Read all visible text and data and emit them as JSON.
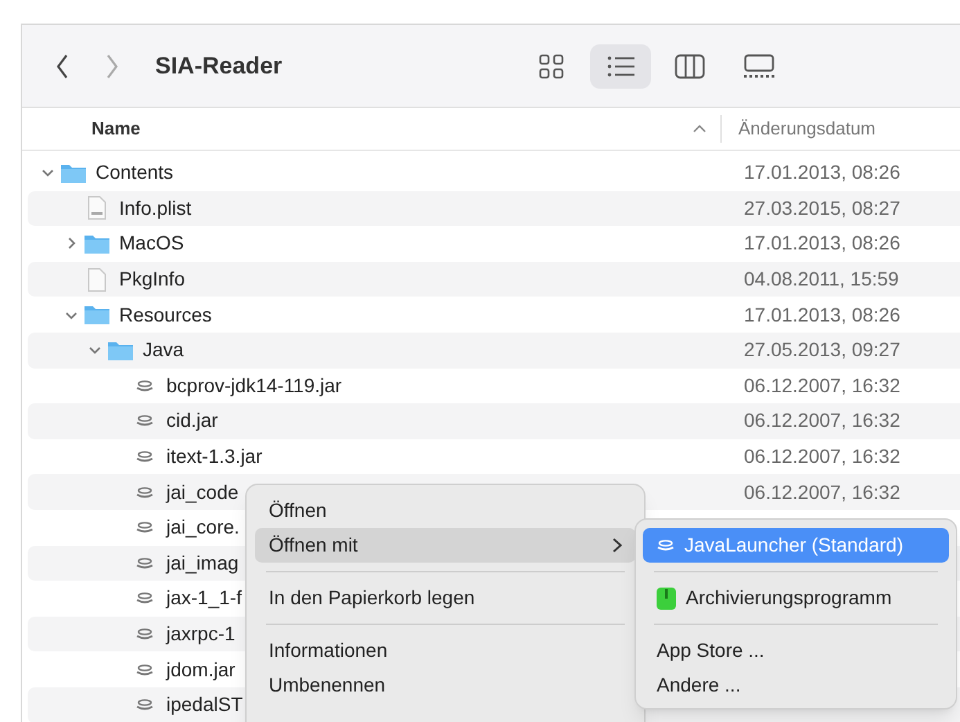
{
  "window": {
    "title": "SIA-Reader"
  },
  "toolbar": {
    "views": [
      {
        "kind": "icons",
        "selected": false
      },
      {
        "kind": "list",
        "selected": true
      },
      {
        "kind": "columns",
        "selected": false
      },
      {
        "kind": "gallery",
        "selected": false
      }
    ]
  },
  "columns": [
    {
      "label": "Name",
      "sorted": true
    },
    {
      "label": "Änderungsdatum",
      "sorted": false
    }
  ],
  "rows": [
    {
      "name": "Contents",
      "kind": "folder",
      "expanded": true,
      "date": "17.01.2013, 08:26",
      "children": [
        {
          "name": "Info.plist",
          "kind": "plist",
          "date": "27.03.2015, 08:27"
        },
        {
          "name": "MacOS",
          "kind": "folder",
          "expanded": false,
          "date": "17.01.2013, 08:26"
        },
        {
          "name": "PkgInfo",
          "kind": "file",
          "date": "04.08.2011, 15:59"
        },
        {
          "name": "Resources",
          "kind": "folder",
          "expanded": true,
          "date": "17.01.2013, 08:26",
          "children": [
            {
              "name": "Java",
              "kind": "folder",
              "expanded": true,
              "date": "27.05.2013, 09:27",
              "children": [
                {
                  "name": "bcprov-jdk14-119.jar",
                  "kind": "jar",
                  "date": "06.12.2007, 16:32"
                },
                {
                  "name": "cid.jar",
                  "kind": "jar",
                  "date": "06.12.2007, 16:32"
                },
                {
                  "name": "itext-1.3.jar",
                  "kind": "jar",
                  "date": "06.12.2007, 16:32"
                },
                {
                  "name": "jai_code",
                  "kind": "jar",
                  "date": "06.12.2007, 16:32"
                },
                {
                  "name": "jai_core.",
                  "kind": "jar"
                },
                {
                  "name": "jai_imag",
                  "kind": "jar"
                },
                {
                  "name": "jax-1_1-f",
                  "kind": "jar"
                },
                {
                  "name": "jaxrpc-1",
                  "kind": "jar"
                },
                {
                  "name": "jdom.jar",
                  "kind": "jar"
                },
                {
                  "name": "ipedalST",
                  "kind": "jar"
                }
              ]
            }
          ]
        }
      ]
    }
  ],
  "context_menu": [
    {
      "kind": "item",
      "label": "Öffnen",
      "selected": false
    },
    {
      "kind": "submenu",
      "label": "Öffnen mit",
      "selected": true
    },
    {
      "kind": "separator"
    },
    {
      "kind": "item",
      "label": "In den Papierkorb legen",
      "selected": false
    },
    {
      "kind": "separator"
    },
    {
      "kind": "item",
      "label": "Informationen",
      "selected": false
    },
    {
      "kind": "item",
      "label": "Umbenennen",
      "selected": false
    }
  ],
  "submenu": [
    {
      "kind": "launcher",
      "label": "JavaLauncher (Standard)",
      "selected": true
    },
    {
      "kind": "separator"
    },
    {
      "kind": "archiver",
      "label": "Archivierungsprogramm",
      "selected": false
    },
    {
      "kind": "separator"
    },
    {
      "kind": "item",
      "label": "App Store ...",
      "selected": false
    },
    {
      "kind": "item",
      "label": "Andere ...",
      "selected": false
    }
  ]
}
